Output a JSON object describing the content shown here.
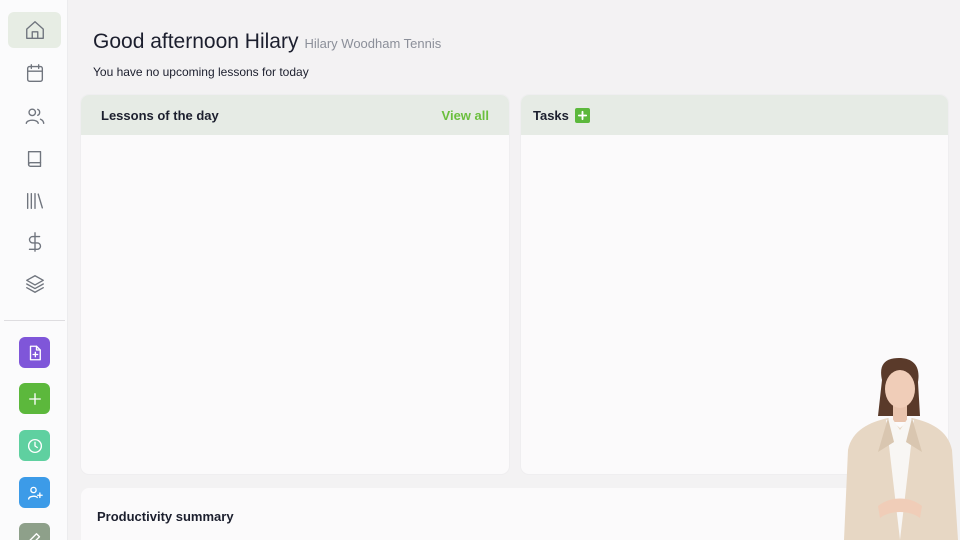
{
  "sidebar": {
    "nav": [
      {
        "icon": "home-icon",
        "active": true
      },
      {
        "icon": "calendar-icon"
      },
      {
        "icon": "users-icon"
      },
      {
        "icon": "book-icon"
      },
      {
        "icon": "library-icon"
      },
      {
        "icon": "dollar-icon"
      },
      {
        "icon": "layers-icon"
      }
    ],
    "quick_actions": [
      {
        "icon": "new-document-icon",
        "color": "#7f56d9"
      },
      {
        "icon": "plus-icon",
        "color": "#5cb83c"
      },
      {
        "icon": "clock-icon",
        "color": "#5fd0a0"
      },
      {
        "icon": "add-user-icon",
        "color": "#3c9be8"
      },
      {
        "icon": "edit-icon",
        "color": "#8ea08a"
      }
    ]
  },
  "header": {
    "greeting": "Good afternoon Hilary",
    "school": "Hilary Woodham Tennis",
    "subtitle": "You have no upcoming lessons for today"
  },
  "lessons": {
    "title": "Lessons of the day",
    "view_all": "View all"
  },
  "tasks": {
    "title": "Tasks"
  },
  "productivity": {
    "title": "Productivity summary"
  },
  "colors": {
    "accent": "#6bbf3d",
    "card_header": "#e6ebe5",
    "background": "#f3f2f3"
  }
}
